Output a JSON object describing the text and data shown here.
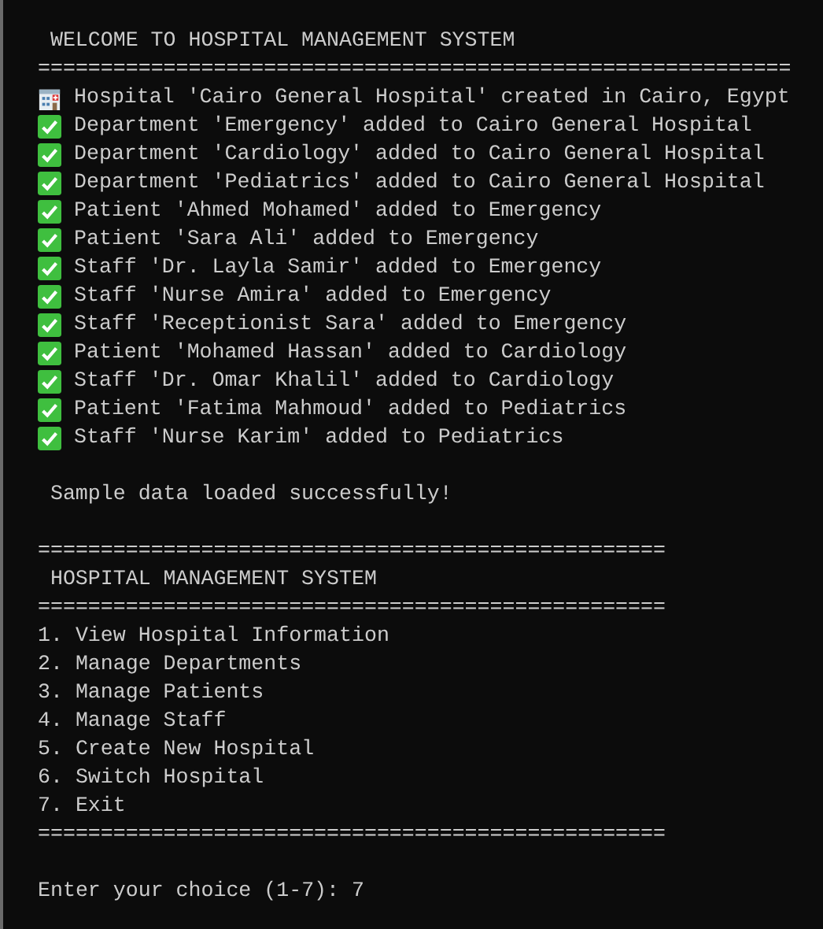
{
  "title": "WELCOME TO HOSPITAL MANAGEMENT SYSTEM",
  "separator": "============================================================",
  "log": [
    {
      "kind": "hospital",
      "text": "Hospital 'Cairo General Hospital' created in Cairo, Egypt"
    },
    {
      "kind": "check",
      "text": "Department 'Emergency' added to Cairo General Hospital"
    },
    {
      "kind": "check",
      "text": "Department 'Cardiology' added to Cairo General Hospital"
    },
    {
      "kind": "check",
      "text": "Department 'Pediatrics' added to Cairo General Hospital"
    },
    {
      "kind": "check",
      "text": "Patient 'Ahmed Mohamed' added to Emergency"
    },
    {
      "kind": "check",
      "text": "Patient 'Sara Ali' added to Emergency"
    },
    {
      "kind": "check",
      "text": "Staff 'Dr. Layla Samir' added to Emergency"
    },
    {
      "kind": "check",
      "text": "Staff 'Nurse Amira' added to Emergency"
    },
    {
      "kind": "check",
      "text": "Staff 'Receptionist Sara' added to Emergency"
    },
    {
      "kind": "check",
      "text": "Patient 'Mohamed Hassan' added to Cardiology"
    },
    {
      "kind": "check",
      "text": "Staff 'Dr. Omar Khalil' added to Cardiology"
    },
    {
      "kind": "check",
      "text": "Patient 'Fatima Mahmoud' added to Pediatrics"
    },
    {
      "kind": "check",
      "text": "Staff 'Nurse Karim' added to Pediatrics"
    }
  ],
  "status": "Sample data loaded successfully!",
  "menu": {
    "separator_top": "==================================================",
    "title": "HOSPITAL MANAGEMENT SYSTEM",
    "separator_mid": "==================================================",
    "items": [
      "1. View Hospital Information",
      "2. Manage Departments",
      "3. Manage Patients",
      "4. Manage Staff",
      "5. Create New Hospital",
      "6. Switch Hospital",
      "7. Exit"
    ],
    "separator_bottom": "=================================================="
  },
  "prompt": {
    "label": "Enter your choice (1-7): ",
    "value": "7"
  }
}
